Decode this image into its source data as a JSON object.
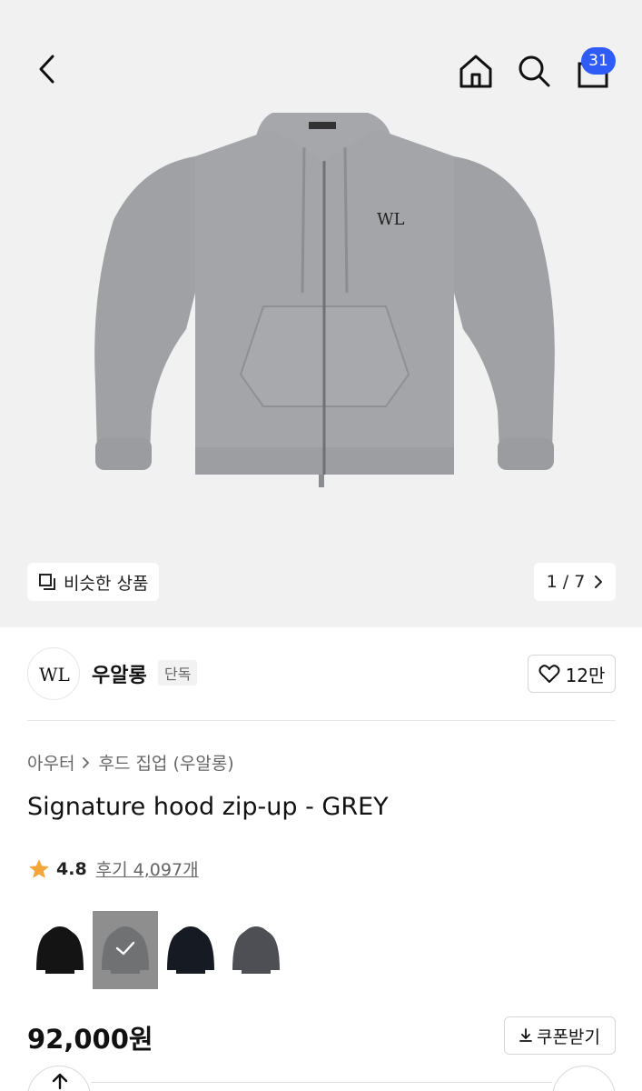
{
  "header": {
    "cart_count": "31"
  },
  "gallery": {
    "similar_label": "비슷한 상품",
    "pager": "1 / 7"
  },
  "brand": {
    "name": "우알롱",
    "badge": "단독",
    "likes": "12만"
  },
  "product": {
    "breadcrumb_category": "아우터",
    "breadcrumb_sub": "후드 집업 (우알롱)",
    "title": "Signature hood zip-up - GREY",
    "rating": "4.8",
    "reviews": "후기 4,097개",
    "price": "92,000원",
    "coupon_label": "쿠폰받기"
  },
  "colors": {
    "accent": "#2f5cf6",
    "star": "#f4a63a",
    "hoodie_grey": "#a0a2a5"
  },
  "swatches": [
    {
      "color": "black",
      "selected": false
    },
    {
      "color": "grey",
      "selected": true
    },
    {
      "color": "navy",
      "selected": false
    },
    {
      "color": "charcoal",
      "selected": false
    }
  ]
}
